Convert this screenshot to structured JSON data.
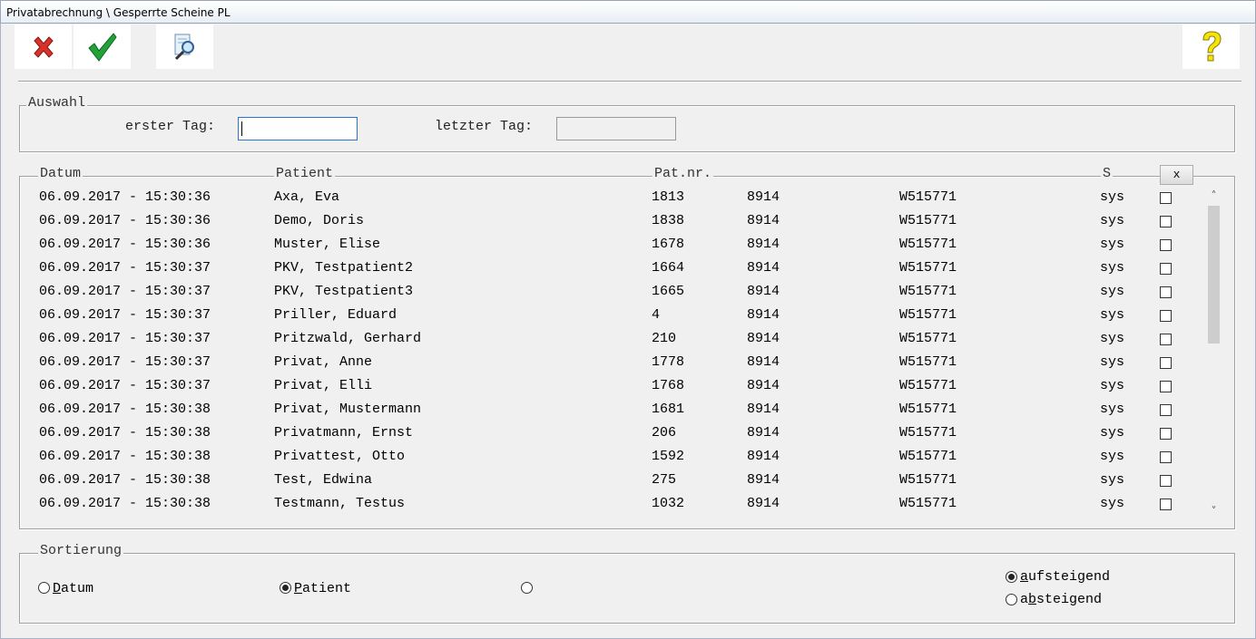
{
  "window": {
    "title": "Privatabrechnung \\ Gesperrte Scheine PL"
  },
  "toolbar": {
    "cancel_icon": "red-x-icon",
    "ok_icon": "green-check-icon",
    "search_icon": "magnifier-document-icon",
    "help_icon": "yellow-question-icon"
  },
  "auswahl": {
    "legend": "Auswahl",
    "first_day_label": "erster Tag:",
    "first_day_value": "",
    "last_day_label": "letzter Tag:",
    "last_day_value": ""
  },
  "list": {
    "columns": {
      "datum": "Datum",
      "patient": "Patient",
      "patnr": "Pat.nr.",
      "s": "S"
    },
    "clear_button": "x",
    "rows": [
      {
        "datum": "06.09.2017 - 15:30:36",
        "patient": "Axa, Eva",
        "patnr": "1813",
        "col4": "8914",
        "col5": "W515771",
        "s": "sys"
      },
      {
        "datum": "06.09.2017 - 15:30:36",
        "patient": "Demo, Doris",
        "patnr": "1838",
        "col4": "8914",
        "col5": "W515771",
        "s": "sys"
      },
      {
        "datum": "06.09.2017 - 15:30:36",
        "patient": "Muster, Elise",
        "patnr": "1678",
        "col4": "8914",
        "col5": "W515771",
        "s": "sys"
      },
      {
        "datum": "06.09.2017 - 15:30:37",
        "patient": "PKV, Testpatient2",
        "patnr": "1664",
        "col4": "8914",
        "col5": "W515771",
        "s": "sys"
      },
      {
        "datum": "06.09.2017 - 15:30:37",
        "patient": "PKV, Testpatient3",
        "patnr": "1665",
        "col4": "8914",
        "col5": "W515771",
        "s": "sys"
      },
      {
        "datum": "06.09.2017 - 15:30:37",
        "patient": "Priller, Eduard",
        "patnr": "4",
        "col4": "8914",
        "col5": "W515771",
        "s": "sys"
      },
      {
        "datum": "06.09.2017 - 15:30:37",
        "patient": "Pritzwald, Gerhard",
        "patnr": "210",
        "col4": "8914",
        "col5": "W515771",
        "s": "sys"
      },
      {
        "datum": "06.09.2017 - 15:30:37",
        "patient": "Privat, Anne",
        "patnr": "1778",
        "col4": "8914",
        "col5": "W515771",
        "s": "sys"
      },
      {
        "datum": "06.09.2017 - 15:30:37",
        "patient": "Privat, Elli",
        "patnr": "1768",
        "col4": "8914",
        "col5": "W515771",
        "s": "sys"
      },
      {
        "datum": "06.09.2017 - 15:30:38",
        "patient": "Privat, Mustermann",
        "patnr": "1681",
        "col4": "8914",
        "col5": "W515771",
        "s": "sys"
      },
      {
        "datum": "06.09.2017 - 15:30:38",
        "patient": "Privatmann, Ernst",
        "patnr": "206",
        "col4": "8914",
        "col5": "W515771",
        "s": "sys"
      },
      {
        "datum": "06.09.2017 - 15:30:38",
        "patient": "Privattest, Otto",
        "patnr": "1592",
        "col4": "8914",
        "col5": "W515771",
        "s": "sys"
      },
      {
        "datum": "06.09.2017 - 15:30:38",
        "patient": "Test, Edwina",
        "patnr": "275",
        "col4": "8914",
        "col5": "W515771",
        "s": "sys"
      },
      {
        "datum": "06.09.2017 - 15:30:38",
        "patient": "Testmann, Testus",
        "patnr": "1032",
        "col4": "8914",
        "col5": "W515771",
        "s": "sys"
      }
    ]
  },
  "sortierung": {
    "legend": "Sortierung",
    "options": [
      {
        "key": "D",
        "rest": "atum",
        "selected": false
      },
      {
        "key": "P",
        "rest": "atient",
        "selected": true
      },
      {
        "key": "",
        "rest": "",
        "selected": false
      }
    ],
    "order": [
      {
        "key": "a",
        "rest": "ufsteigend",
        "selected": true
      },
      {
        "pre": "a",
        "key": "b",
        "rest": "steigend",
        "selected": false
      }
    ]
  }
}
